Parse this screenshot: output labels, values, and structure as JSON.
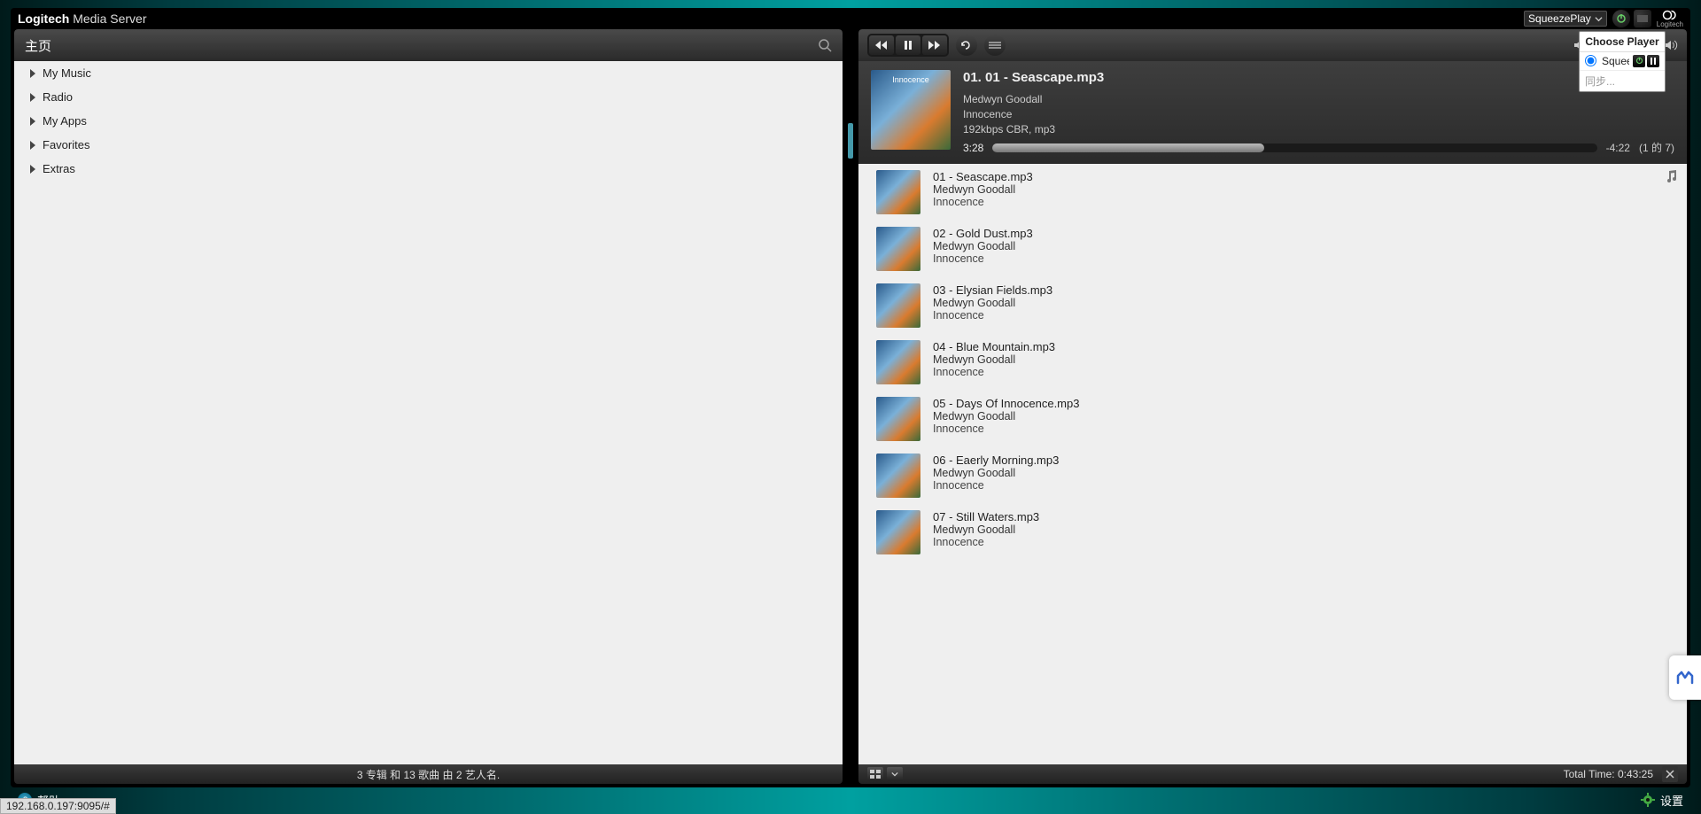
{
  "brand": {
    "light": "Logitech",
    "bold": " Media Server",
    "footer_logo": "Logitech"
  },
  "player_select": {
    "label": "SqueezePlay"
  },
  "player_popup": {
    "header": "Choose Player",
    "players": [
      {
        "name": "SqueezePlay",
        "selected": true
      }
    ],
    "sync": "同步..."
  },
  "left": {
    "crumb": "主页",
    "items": [
      {
        "label": "My Music"
      },
      {
        "label": "Radio"
      },
      {
        "label": "My Apps"
      },
      {
        "label": "Favorites"
      },
      {
        "label": "Extras"
      }
    ],
    "status": "3 专辑 和 13 歌曲 由 2 艺人名."
  },
  "player": {
    "cover_text": "Innocence",
    "title": "01. 01 - Seascape.mp3",
    "artist": "Medwyn Goodall",
    "album": "Innocence",
    "format": "192kbps CBR, mp3",
    "elapsed": "3:28",
    "remaining": "-4:22",
    "queue_pos": "(1 的 7)"
  },
  "playlist": [
    {
      "title": "01 - Seascape.mp3",
      "artist": "Medwyn Goodall",
      "album": "Innocence"
    },
    {
      "title": "02 - Gold Dust.mp3",
      "artist": "Medwyn Goodall",
      "album": "Innocence"
    },
    {
      "title": "03 - Elysian Fields.mp3",
      "artist": "Medwyn Goodall",
      "album": "Innocence"
    },
    {
      "title": "04 - Blue Mountain.mp3",
      "artist": "Medwyn Goodall",
      "album": "Innocence"
    },
    {
      "title": "05 - Days Of Innocence.mp3",
      "artist": "Medwyn Goodall",
      "album": "Innocence"
    },
    {
      "title": "06 - Eaerly Morning.mp3",
      "artist": "Medwyn Goodall",
      "album": "Innocence"
    },
    {
      "title": "07 - Still Waters.mp3",
      "artist": "Medwyn Goodall",
      "album": "Innocence"
    }
  ],
  "right_status": {
    "total": "Total Time: 0:43:25"
  },
  "footer": {
    "help": "帮助",
    "settings": "设置"
  },
  "url": "192.168.0.197:9095/#"
}
